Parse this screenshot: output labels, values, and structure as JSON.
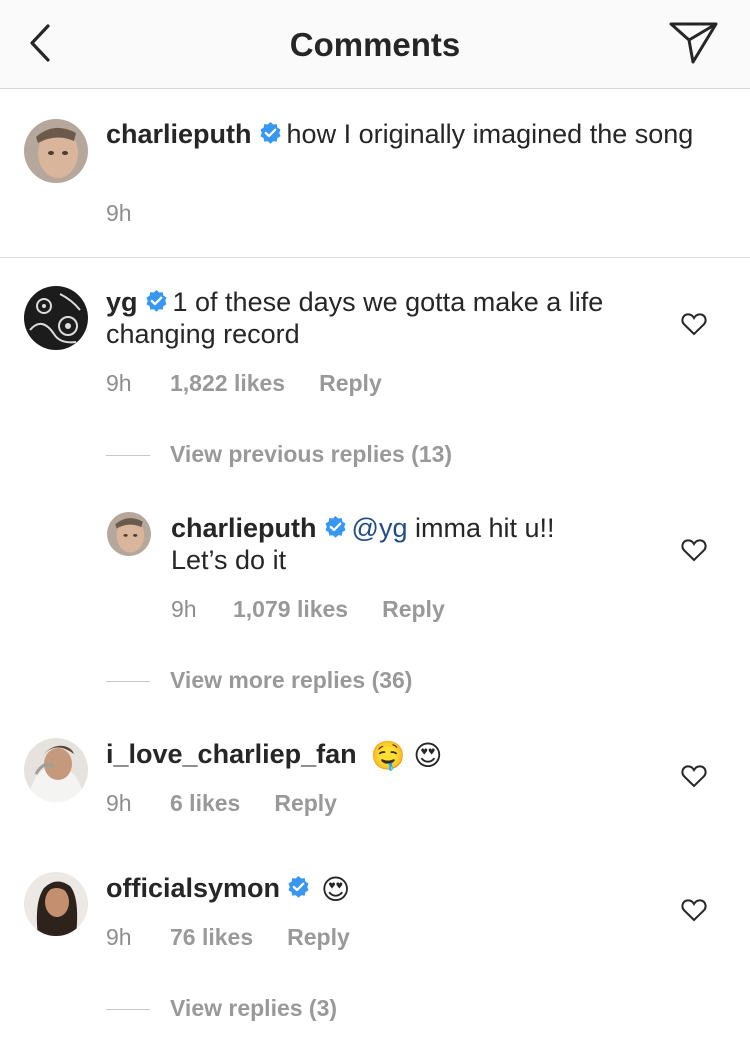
{
  "header": {
    "title": "Comments",
    "back_icon": "chevron-left-icon",
    "share_icon": "send-icon"
  },
  "caption": {
    "username": "charlieputh",
    "text": "how I originally imagined the song",
    "time": "9h"
  },
  "comments": [
    {
      "username": "yg",
      "text": "1 of these days we gotta make a life changing record",
      "time": "9h",
      "likes": "1,822 likes",
      "reply": "Reply",
      "view_replies": "View previous replies (13)",
      "reply_item": {
        "username": "charlieputh",
        "mention": "@yg",
        "text": " imma hit u!! Let’s do it",
        "time": "9h",
        "likes": "1,079 likes",
        "reply": "Reply"
      },
      "more_replies": "View more replies (36)"
    },
    {
      "username": "i_love_charliep_fan",
      "text": "🤤 😍",
      "time": "9h",
      "likes": "6 likes",
      "reply": "Reply"
    },
    {
      "username": "officialsymon",
      "text": "😍",
      "time": "9h",
      "likes": "76 likes",
      "reply": "Reply",
      "view_replies": "View replies (3)"
    }
  ],
  "colors": {
    "verified": "#3897f0",
    "mention": "#1f4d88",
    "meta": "#8e8e8e"
  }
}
